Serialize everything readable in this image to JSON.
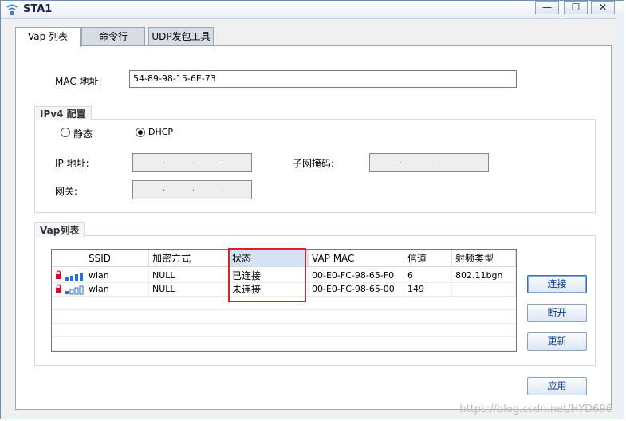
{
  "window": {
    "title": "STA1",
    "minimize": "—",
    "maximize": "☐",
    "close": "✕"
  },
  "tabs": [
    {
      "label": "Vap 列表",
      "active": true
    },
    {
      "label": "命令行",
      "active": false
    },
    {
      "label": "UDP发包工具",
      "active": false
    }
  ],
  "mac": {
    "label": "MAC 地址:",
    "value": "54-89-98-15-6E-73"
  },
  "ipv4": {
    "title": "IPv4 配置",
    "static_label": "静态",
    "dhcp_label": "DHCP",
    "selected": "DHCP",
    "ip_label": "IP 地址:",
    "mask_label": "子网掩码:",
    "gateway_label": "网关:",
    "dot": "."
  },
  "vap": {
    "title": "Vap列表",
    "columns": [
      "",
      "SSID",
      "加密方式",
      "状态",
      "VAP MAC",
      "信道",
      "射频类型"
    ],
    "rows": [
      {
        "ssid": "wlan",
        "encryption": "NULL",
        "status": "已连接",
        "mac": "00-E0-FC-98-65-F0",
        "channel": "6",
        "radio": "802.11bgn",
        "signal_bars": 4
      },
      {
        "ssid": "wlan",
        "encryption": "NULL",
        "status": "未连接",
        "mac": "00-E0-FC-98-65-00",
        "channel": "149",
        "radio": "",
        "signal_bars": 1
      }
    ],
    "icons": [
      "lock-icon",
      "signal-strength-icon"
    ]
  },
  "buttons": {
    "connect": "连接",
    "disconnect": "断开",
    "refresh": "更新",
    "apply": "应用"
  },
  "watermark": "https://blog.csdn.net/HYD696",
  "colors": {
    "highlight_box": "#e02020",
    "header_selected": "#d5e2f2",
    "signal": "#2a6fd0",
    "lock": "#c8102e"
  }
}
